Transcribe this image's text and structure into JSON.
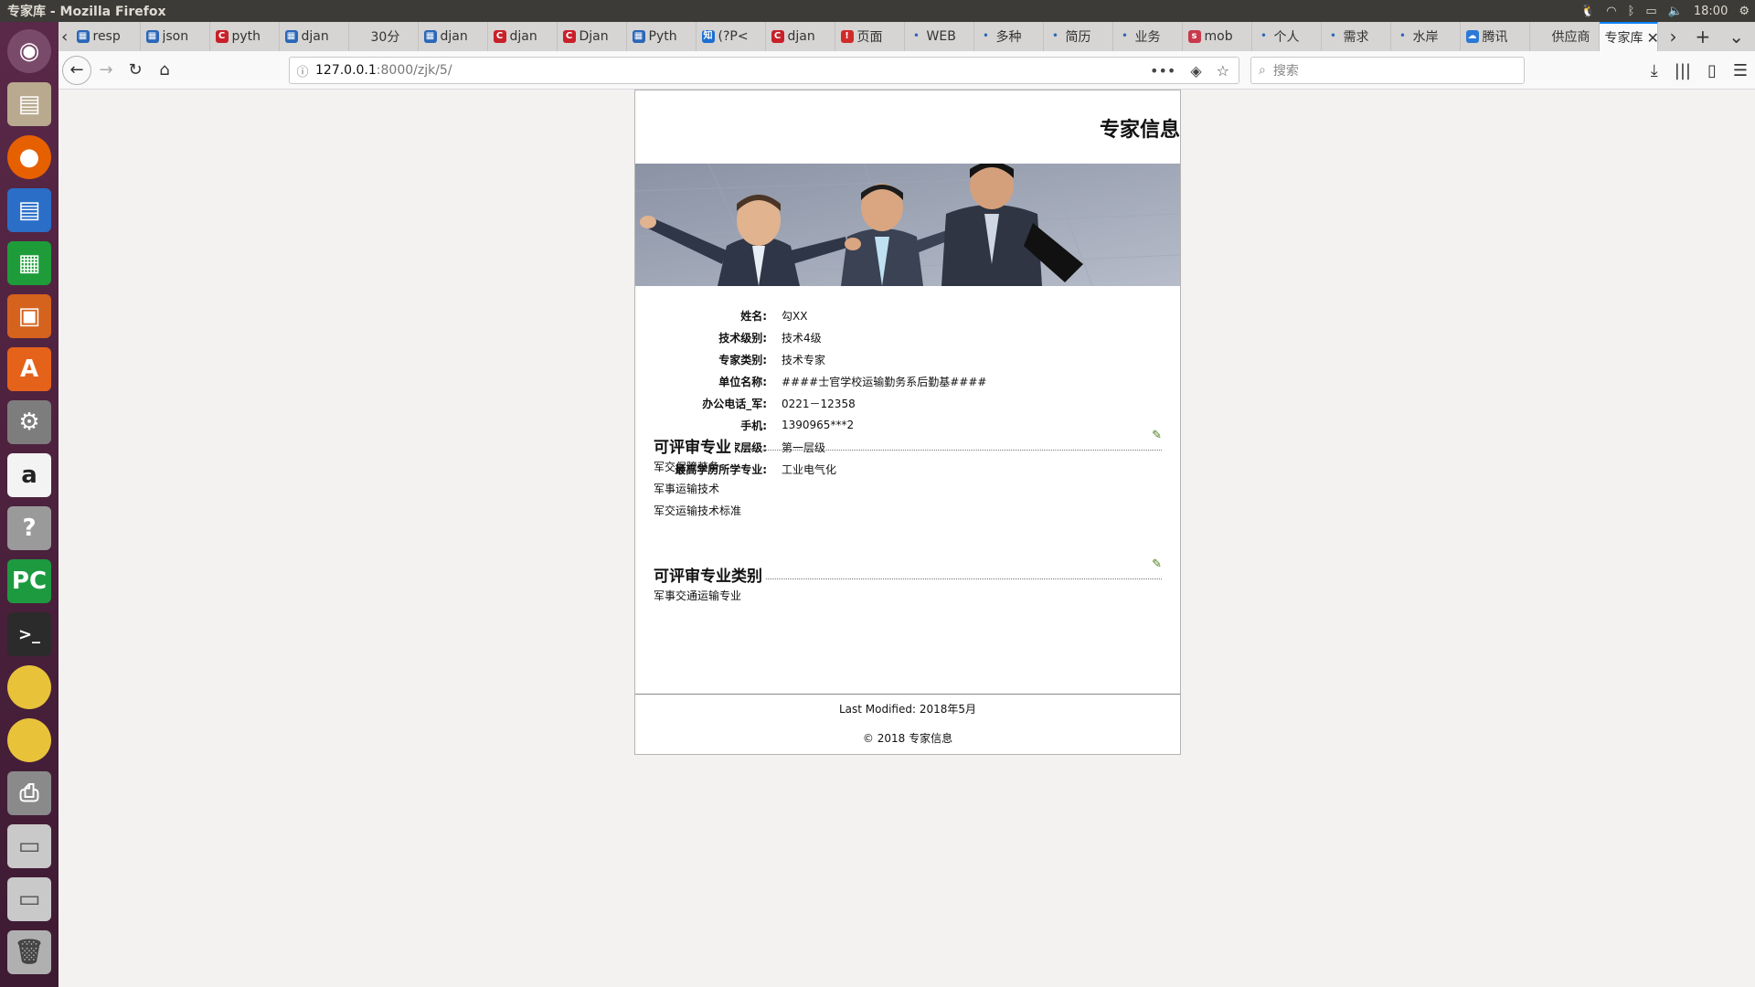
{
  "window_title": "专家库 - Mozilla Firefox",
  "tray": {
    "time": "18:00"
  },
  "tabs": [
    {
      "label": "resp",
      "fav": "doc",
      "color": "#2a66b8"
    },
    {
      "label": "json",
      "fav": "doc",
      "color": "#2a66b8"
    },
    {
      "label": "pyth",
      "fav": "C",
      "color": "#c9202a"
    },
    {
      "label": "djan",
      "fav": "doc",
      "color": "#2a66b8"
    },
    {
      "label": "30分",
      "fav": "",
      "color": "#d6d5d3"
    },
    {
      "label": "djan",
      "fav": "doc",
      "color": "#2a66b8"
    },
    {
      "label": "djan",
      "fav": "C",
      "color": "#c9202a"
    },
    {
      "label": "Djan",
      "fav": "C",
      "color": "#c9202a"
    },
    {
      "label": "Pyth",
      "fav": "doc",
      "color": "#2a66b8"
    },
    {
      "label": "(?P<",
      "fav": "知",
      "color": "#1c6fd1"
    },
    {
      "label": "djan",
      "fav": "C",
      "color": "#c9202a"
    },
    {
      "label": "页面",
      "fav": "!",
      "color": "#d12a2a"
    },
    {
      "label": "WEB",
      "fav": "•",
      "color": "#d6d5d3"
    },
    {
      "label": "多种",
      "fav": "•",
      "color": "#d6d5d3"
    },
    {
      "label": "简历",
      "fav": "•",
      "color": "#d6d5d3"
    },
    {
      "label": "业务",
      "fav": "•",
      "color": "#d6d5d3"
    },
    {
      "label": "mob",
      "fav": "s",
      "color": "#c9394c"
    },
    {
      "label": "个人",
      "fav": "•",
      "color": "#d6d5d3"
    },
    {
      "label": "需求",
      "fav": "•",
      "color": "#d6d5d3"
    },
    {
      "label": "水岸",
      "fav": "•",
      "color": "#d6d5d3"
    },
    {
      "label": "腾讯",
      "fav": "☁",
      "color": "#2b78d6"
    },
    {
      "label": "供应商",
      "fav": "",
      "color": "#d6d5d3"
    }
  ],
  "active_tab": {
    "label": "专家库"
  },
  "url": {
    "host": "127.0.0.1",
    "path": ":8000/zjk/5/"
  },
  "search": {
    "placeholder": "搜索"
  },
  "page": {
    "title": "专家信息",
    "info": [
      {
        "label": "姓名:",
        "value": "勾XX"
      },
      {
        "label": "技术级别:",
        "value": "技术4级"
      },
      {
        "label": "专家类别:",
        "value": "技术专家"
      },
      {
        "label": "单位名称:",
        "value": "####士官学校运输勤务系后勤基####"
      },
      {
        "label": "办公电话_军:",
        "value": "0221－12358"
      },
      {
        "label": "手机:",
        "value": "1390965***2"
      },
      {
        "label": "专家层级:",
        "value": "第一层级"
      },
      {
        "label": "最高学历所学专业:",
        "value": "工业电气化"
      }
    ],
    "sections": [
      {
        "heading": "可评审专业",
        "items": [
          "军交保障装备",
          "军事运输技术",
          "军交运输技术标准"
        ]
      },
      {
        "heading": "可评审专业类别",
        "items": [
          "军事交通运输专业"
        ]
      }
    ],
    "footer": {
      "modified": "Last Modified: 2018年5月",
      "copyright": "© 2018 专家信息"
    }
  }
}
